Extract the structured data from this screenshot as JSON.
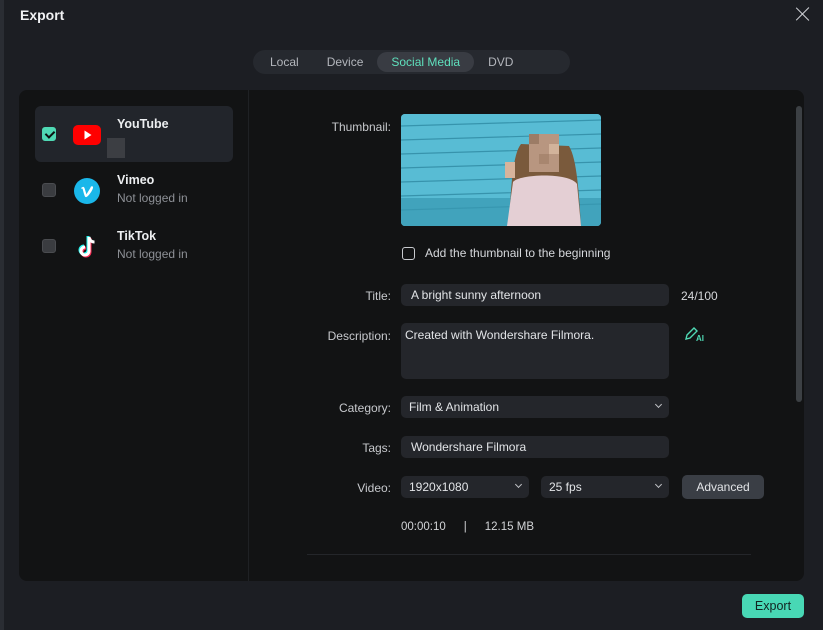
{
  "window": {
    "title": "Export"
  },
  "tabs": [
    {
      "label": "Local",
      "active": false
    },
    {
      "label": "Device",
      "active": false
    },
    {
      "label": "Social Media",
      "active": true
    },
    {
      "label": "DVD",
      "active": false
    }
  ],
  "platforms": [
    {
      "name": "YouTube",
      "status": "",
      "checked": true,
      "icon": "youtube-icon"
    },
    {
      "name": "Vimeo",
      "status": "Not logged in",
      "checked": false,
      "icon": "vimeo-icon"
    },
    {
      "name": "TikTok",
      "status": "Not logged in",
      "checked": false,
      "icon": "tiktok-icon"
    }
  ],
  "form": {
    "thumbnail_label": "Thumbnail:",
    "add_thumbnail_label": "Add the thumbnail to the beginning",
    "add_thumbnail_checked": false,
    "title_label": "Title:",
    "title_value": "A bright sunny afternoon",
    "title_counter": "24/100",
    "description_label": "Description:",
    "description_value": "Created with Wondershare Filmora.",
    "ai_button": "AI",
    "category_label": "Category:",
    "category_value": "Film & Animation",
    "tags_label": "Tags:",
    "tags_value": "Wondershare Filmora",
    "video_label": "Video:",
    "resolution_value": "1920x1080",
    "fps_value": "25 fps",
    "advanced_label": "Advanced",
    "duration": "00:00:10",
    "separator": "|",
    "file_size": "12.15 MB"
  },
  "footer": {
    "export_label": "Export"
  },
  "colors": {
    "accent": "#48d8b5",
    "youtube": "#ff0000",
    "vimeo": "#1ab7ea"
  }
}
